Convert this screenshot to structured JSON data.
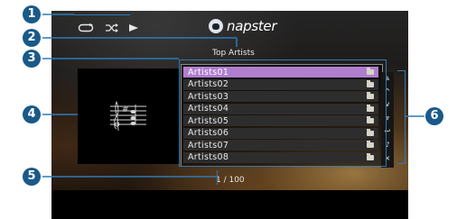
{
  "service_logo": "napster",
  "screen_title": "Top Artists",
  "list_items": [
    {
      "label": "Artists01",
      "selected": true
    },
    {
      "label": "Artists02",
      "selected": false
    },
    {
      "label": "Artists03",
      "selected": false
    },
    {
      "label": "Artists04",
      "selected": false
    },
    {
      "label": "Artists05",
      "selected": false
    },
    {
      "label": "Artists06",
      "selected": false
    },
    {
      "label": "Artists07",
      "selected": false
    },
    {
      "label": "Artists08",
      "selected": false
    }
  ],
  "row_icon": "folder-icon",
  "status_icons": [
    "repeat-icon",
    "shuffle-icon",
    "play-icon"
  ],
  "artwork_icon": "sheet-music-icon",
  "page_indicator": "1 / 100",
  "side_buttons": [
    "page-up-icon",
    "up-icon",
    "down-icon",
    "page-down-icon",
    "return-icon",
    "now-playing-icon",
    "close-icon"
  ],
  "side_glyphs": [
    "⩓",
    "^",
    "v",
    "⩔",
    "↩",
    "♪",
    "×"
  ],
  "callouts": [
    "1",
    "2",
    "3",
    "4",
    "5",
    "6"
  ],
  "colors": {
    "selection": "#b07ecf",
    "callout": "#1a5a89",
    "bracket": "#2f7ab6"
  }
}
